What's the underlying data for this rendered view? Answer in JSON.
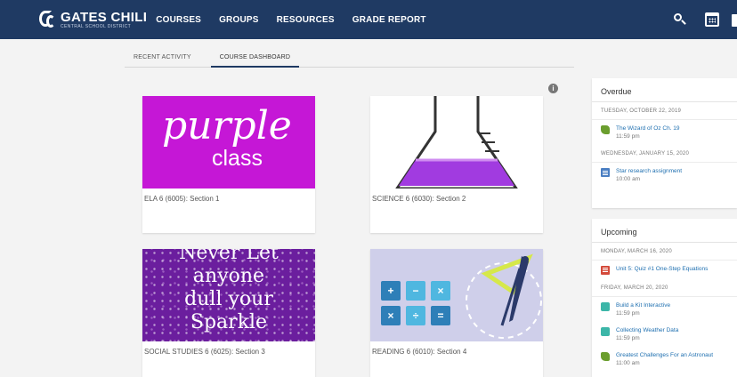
{
  "header": {
    "logo_title": "GATES CHILI",
    "logo_subtitle": "CENTRAL SCHOOL DISTRICT",
    "nav": [
      "COURSES",
      "GROUPS",
      "RESOURCES",
      "GRADE REPORT"
    ],
    "icons": [
      "search-icon",
      "calendar-icon"
    ]
  },
  "tabs": [
    "RECENT ACTIVITY",
    "COURSE DASHBOARD"
  ],
  "active_tab": "COURSE DASHBOARD",
  "courses": [
    {
      "title": "ELA 6 (6005): Section 1",
      "image_text": [
        "purple",
        "class"
      ]
    },
    {
      "title": "SCIENCE 6 (6030): Section 2"
    },
    {
      "title": "SOCIAL STUDIES 6 (6025): Section 3",
      "image_text": [
        "Never Let",
        "anyone",
        "dull your",
        "Sparkle"
      ]
    },
    {
      "title": "READING 6 (6010): Section 4",
      "image_text": [
        "+",
        "−",
        "×",
        "×",
        "÷",
        "="
      ]
    }
  ],
  "overdue": {
    "heading": "Overdue",
    "groups": [
      {
        "date": "TUESDAY, OCTOBER 22, 2019",
        "items": [
          {
            "title": "The Wizard of Oz Ch. 19",
            "time": "11:59 pm",
            "icon": "pencil-icon"
          }
        ]
      },
      {
        "date": "WEDNESDAY, JANUARY 15, 2020",
        "items": [
          {
            "title": "Star research assignment",
            "time": "10:00 am",
            "icon": "document-icon"
          }
        ]
      }
    ]
  },
  "upcoming": {
    "heading": "Upcoming",
    "groups": [
      {
        "date": "MONDAY, MARCH 16, 2020",
        "items": [
          {
            "title": "Unit 5: Quiz #1 One-Step Equations",
            "time": "",
            "icon": "quiz-icon"
          }
        ]
      },
      {
        "date": "FRIDAY, MARCH 20, 2020",
        "items": [
          {
            "title": "Build a Kit Interactive",
            "time": "11:59 pm",
            "icon": "puzzle-icon"
          },
          {
            "title": "Collecting Weather Data",
            "time": "11:59 pm",
            "icon": "puzzle-icon"
          },
          {
            "title": "Greatest Challenges For an Astronaut",
            "time": "11:00 am",
            "icon": "pencil-icon"
          }
        ]
      }
    ]
  },
  "colors": {
    "nav_bg": "#1f3a63",
    "link": "#1e6fb0",
    "ela": "#c517d6",
    "sparkle": "#6b1e9e",
    "science_liquid": "#a13be0"
  }
}
